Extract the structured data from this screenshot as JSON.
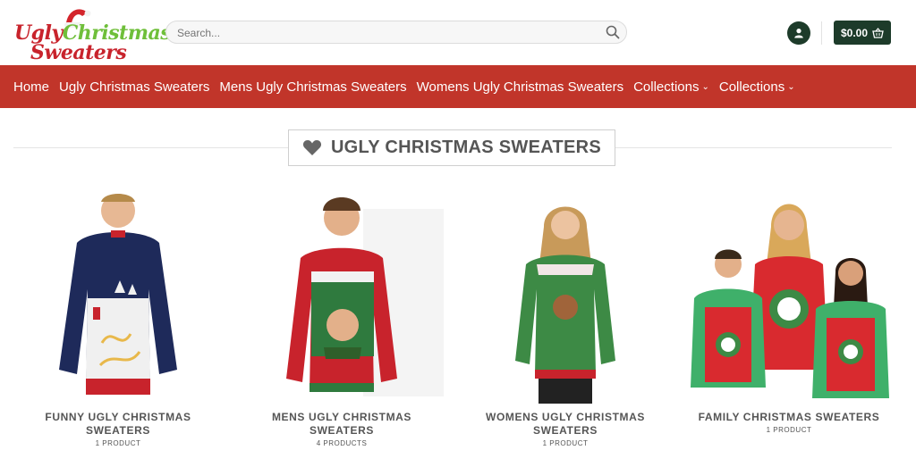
{
  "header": {
    "logo": {
      "line1_word1": "Ugly",
      "line1_word2": "Christmas",
      "line2": "Sweaters"
    },
    "search": {
      "placeholder": "Search..."
    },
    "cart": {
      "amount": "$0.00"
    },
    "colors": {
      "accent": "#c1352a",
      "dark_green": "#1d3b2a"
    }
  },
  "nav": {
    "items": [
      {
        "label": "Home"
      },
      {
        "label": "Ugly Christmas Sweaters"
      },
      {
        "label": "Mens Ugly Christmas Sweaters"
      },
      {
        "label": "Womens Ugly Christmas Sweaters"
      },
      {
        "label": "Collections"
      },
      {
        "label": "Collections"
      }
    ]
  },
  "section": {
    "title": "UGLY CHRISTMAS SWEATERS",
    "icon": "heart-icon"
  },
  "products": [
    {
      "name_line1": "FUNNY UGLY CHRISTMAS",
      "name_line2": "SWEATERS",
      "count": "1 PRODUCT"
    },
    {
      "name_line1": "MENS UGLY CHRISTMAS",
      "name_line2": "SWEATERS",
      "count": "4 PRODUCTS"
    },
    {
      "name_line1": "WOMENS UGLY CHRISTMAS",
      "name_line2": "SWEATERS",
      "count": "1 PRODUCT"
    },
    {
      "name_line1": "FAMILY CHRISTMAS SWEATERS",
      "name_line2": "",
      "count": "1 PRODUCT"
    }
  ]
}
